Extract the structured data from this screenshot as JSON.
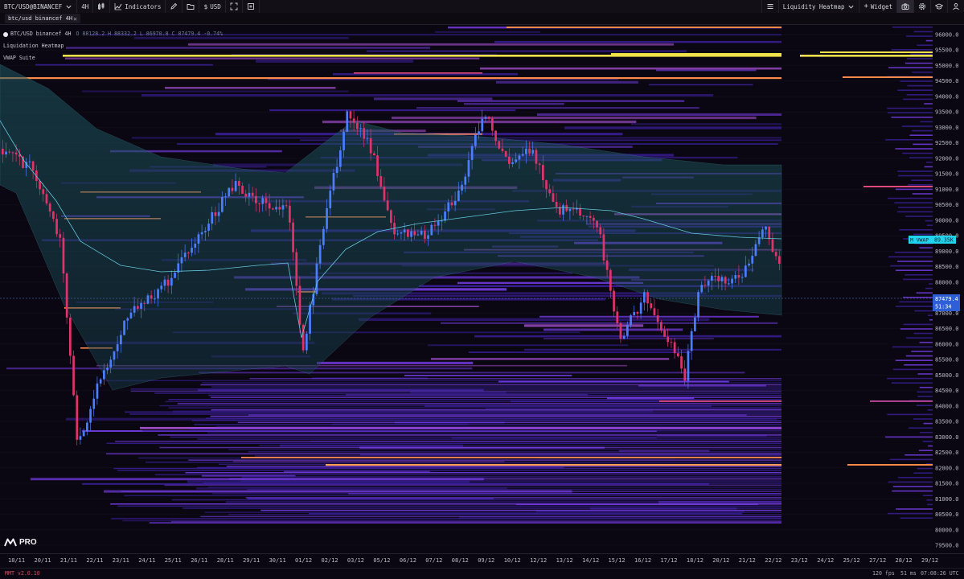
{
  "toolbar": {
    "symbol": "BTC/USD@BINANCEF",
    "interval": "4H",
    "indicators_label": "Indicators",
    "currency": "USD",
    "heatmap_select": "Liquidity Heatmap",
    "widget_label": "Widget"
  },
  "tab": {
    "label": "btc/usd binancef 4H",
    "close": "✕"
  },
  "legend": {
    "series_title": "BTC/USD binancef 4H",
    "ohlc": "O 88128.2 H 88332.2 L 86970.8 C 87479.4 -0.74%",
    "indicator_1": "Liquidation Heatmap",
    "indicator_2": "VWAP Suite"
  },
  "price_axis": {
    "ticks": [
      "96000.0",
      "95500.0",
      "95000.0",
      "94500.0",
      "94000.0",
      "93500.0",
      "93000.0",
      "92500.0",
      "92000.0",
      "91500.0",
      "91000.0",
      "90500.0",
      "90000.0",
      "89500.0",
      "89000.0",
      "88500.0",
      "88000.0",
      "87500.0",
      "87000.0",
      "86500.0",
      "86000.0",
      "85500.0",
      "85000.0",
      "84500.0",
      "84000.0",
      "83500.0",
      "83000.0",
      "82500.0",
      "82000.0",
      "81500.0",
      "81000.0",
      "80500.0",
      "80000.0",
      "79500.0"
    ],
    "vwap_badge_label": "M VWAP",
    "vwap_badge_value": "89.35K",
    "last_price": "87479.4",
    "countdown": "51:34"
  },
  "time_axis": {
    "labels": [
      "18/11",
      "20/11",
      "21/11",
      "22/11",
      "23/11",
      "24/11",
      "25/11",
      "26/11",
      "28/11",
      "29/11",
      "30/11",
      "01/12",
      "02/12",
      "03/12",
      "05/12",
      "06/12",
      "07/12",
      "08/12",
      "09/12",
      "10/12",
      "12/12",
      "13/12",
      "14/12",
      "15/12",
      "16/12",
      "17/12",
      "18/12",
      "20/12",
      "21/12",
      "22/12",
      "23/12",
      "24/12",
      "25/12",
      "27/12",
      "28/12",
      "29/12"
    ]
  },
  "status": {
    "version": "MMT v2.0.10",
    "fps": "120 fps",
    "latency": "51 ms",
    "clock": "07:08:26 UTC"
  },
  "brand": {
    "logo": "PRO"
  },
  "colors": {
    "bg": "#0b0712",
    "up": "#4a7dff",
    "down": "#e0336a",
    "vwap_line": "#62c6dc",
    "badge": "#22d3ee",
    "heat_low": "#3a1f9a",
    "heat_mid": "#7a3ff0",
    "heat_high": "#ff8a4a",
    "heat_max": "#f2e24a"
  }
}
